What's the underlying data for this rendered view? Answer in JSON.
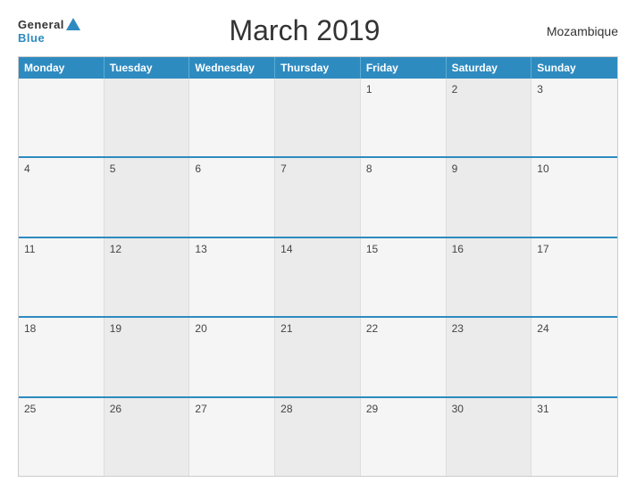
{
  "header": {
    "logo_general": "General",
    "logo_blue": "Blue",
    "title": "March 2019",
    "country": "Mozambique"
  },
  "calendar": {
    "days_of_week": [
      "Monday",
      "Tuesday",
      "Wednesday",
      "Thursday",
      "Friday",
      "Saturday",
      "Sunday"
    ],
    "weeks": [
      [
        {
          "day": "",
          "empty": true
        },
        {
          "day": "",
          "empty": true
        },
        {
          "day": "",
          "empty": true
        },
        {
          "day": "",
          "empty": true
        },
        {
          "day": "1"
        },
        {
          "day": "2"
        },
        {
          "day": "3"
        }
      ],
      [
        {
          "day": "4"
        },
        {
          "day": "5"
        },
        {
          "day": "6"
        },
        {
          "day": "7"
        },
        {
          "day": "8"
        },
        {
          "day": "9"
        },
        {
          "day": "10"
        }
      ],
      [
        {
          "day": "11"
        },
        {
          "day": "12"
        },
        {
          "day": "13"
        },
        {
          "day": "14"
        },
        {
          "day": "15"
        },
        {
          "day": "16"
        },
        {
          "day": "17"
        }
      ],
      [
        {
          "day": "18"
        },
        {
          "day": "19"
        },
        {
          "day": "20"
        },
        {
          "day": "21"
        },
        {
          "day": "22"
        },
        {
          "day": "23"
        },
        {
          "day": "24"
        }
      ],
      [
        {
          "day": "25"
        },
        {
          "day": "26"
        },
        {
          "day": "27"
        },
        {
          "day": "28"
        },
        {
          "day": "29"
        },
        {
          "day": "30"
        },
        {
          "day": "31"
        }
      ]
    ]
  }
}
